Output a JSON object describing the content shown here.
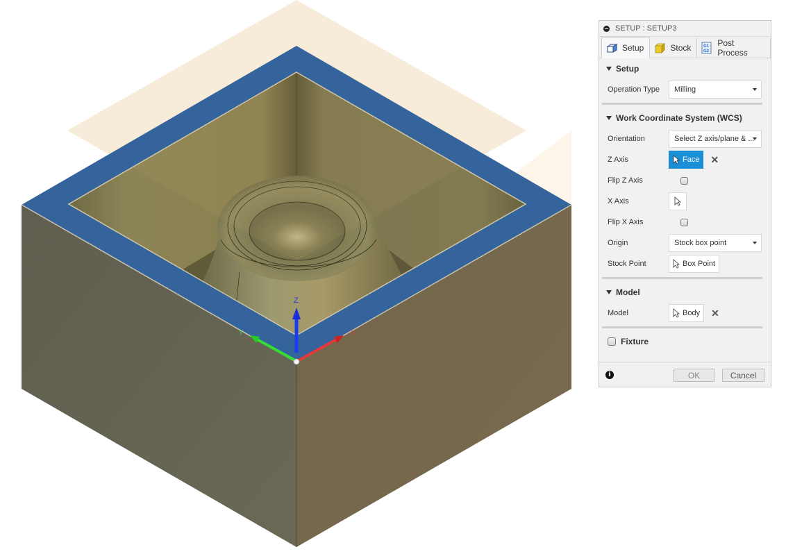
{
  "viewport": {
    "axis_labels": {
      "z": "Z",
      "x": "X",
      "y": "Y"
    },
    "colors": {
      "rim_blue": "#35639b",
      "part_olive": "#8a8050",
      "left_face": "#666552",
      "right_face": "#74674d",
      "plane_tint": "#fdf3e6",
      "z_axis": "#1a3cf0",
      "x_axis": "#e23a3a",
      "y_axis": "#33dd33"
    }
  },
  "panel": {
    "title": "SETUP : SETUP3",
    "tabs": [
      {
        "label": "Setup",
        "icon": "setup-cube-icon",
        "active": true
      },
      {
        "label": "Stock",
        "icon": "stock-cube-icon",
        "active": false
      },
      {
        "label": "Post Process",
        "icon": "g1g2-icon",
        "active": false
      }
    ],
    "sections": {
      "setup": {
        "heading": "Setup",
        "operation_type_label": "Operation Type",
        "operation_type_value": "Milling"
      },
      "wcs": {
        "heading": "Work Coordinate System (WCS)",
        "orientation_label": "Orientation",
        "orientation_value": "Select Z axis/plane & ...",
        "z_axis_label": "Z Axis",
        "z_axis_value": "Face",
        "flip_z_label": "Flip Z Axis",
        "flip_z_checked": false,
        "x_axis_label": "X Axis",
        "flip_x_label": "Flip X Axis",
        "flip_x_checked": false,
        "origin_label": "Origin",
        "origin_value": "Stock box point",
        "stock_point_label": "Stock Point",
        "stock_point_value": "Box Point"
      },
      "model": {
        "heading": "Model",
        "model_label": "Model",
        "model_value": "Body"
      },
      "fixture": {
        "label": "Fixture",
        "checked": false
      }
    },
    "footer": {
      "ok_label": "OK",
      "cancel_label": "Cancel"
    },
    "colors": {
      "accent": "#1a8fd6",
      "panel_bg": "#f1f1f1"
    }
  }
}
